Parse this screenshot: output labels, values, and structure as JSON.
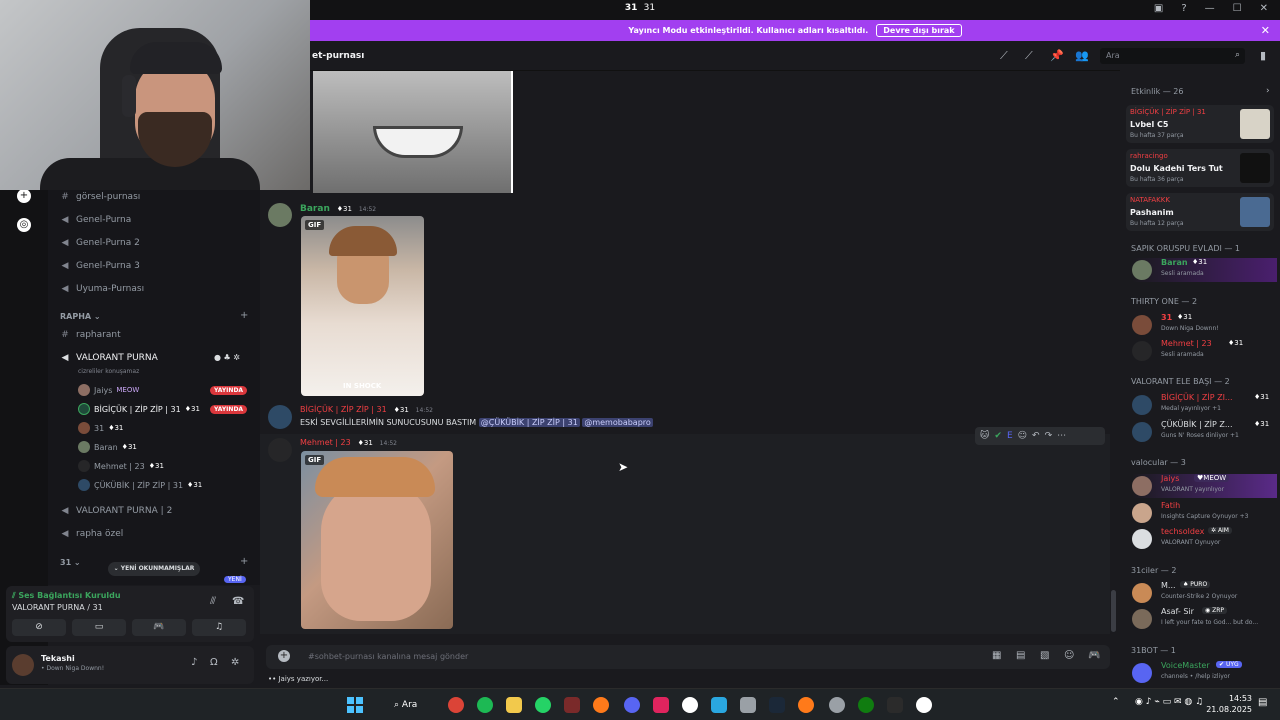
{
  "titlebar": {
    "title": "31",
    "subtitle": "31"
  },
  "banner": {
    "text": "Yayıncı Modu etkinleştirildi. Kullanıcı adları kısaltıldı.",
    "button": "Devre dışı bırak"
  },
  "channel": {
    "name": "et-purnası",
    "search_placeholder": "Ara"
  },
  "sidebar": {
    "channels": [
      "görsel-purnası",
      "Genel-Purna",
      "Genel-Purna 2",
      "Genel-Purna 3",
      "Uyuma-Purnası"
    ],
    "category_rapha": "RAPHA",
    "rapharant": "rapharant",
    "valorant_purna": "VALORANT PURNA",
    "valorant_sub": "cizreliler konuşamaz",
    "voice_users": [
      {
        "name": "Jaiys",
        "tag": "MEOW",
        "live": "YAYINDA"
      },
      {
        "name": "BİGİÇÜK | ZİP ZİP | 31",
        "tag": "31",
        "live": "YAYINDA"
      },
      {
        "name": "31",
        "tag": "31",
        "live": ""
      },
      {
        "name": "Baran",
        "tag": "31",
        "live": ""
      },
      {
        "name": "Mehmet | 23",
        "tag": "31",
        "live": ""
      },
      {
        "name": "ÇÜKÜBİK | ZİP ZİP | 31",
        "tag": "31",
        "live": ""
      }
    ],
    "valorant2": "VALORANT PURNA | 2",
    "rapha_ozel": "rapha özel",
    "category_31": "31",
    "new_unread": "YENİ OKUNMAMIŞLAR",
    "yeni": "YENİ"
  },
  "voice_panel": {
    "status": "Ses Bağlantısı Kuruldu",
    "channel": "VALORANT PURNA / 31"
  },
  "user_panel": {
    "name": "Tekashi",
    "status": "Down Niga Downn!"
  },
  "messages": [
    {
      "author": "Baran",
      "tag": "31",
      "time": "14:52",
      "gif": "GIF",
      "caption": "IN SHOCK"
    },
    {
      "author": "BİGİÇÜK | ZİP ZİP | 31",
      "tag": "31",
      "time": "14:52",
      "text": "ESKİ SEVGİLİLERİMİN SUNUCUSUNU BASTIM",
      "mention1": "@ÇÜKÜBİK | ZİP ZİP | 31",
      "mention2": "@memobabapro"
    },
    {
      "author": "Mehmet | 23",
      "tag": "31",
      "time": "14:52",
      "gif": "GIF"
    }
  ],
  "composer": {
    "placeholder": "#sohbet-purnası kanalına mesaj gönder",
    "typing": "Jaiys yazıyor..."
  },
  "right": {
    "activity_header": "Etkinlik — 26",
    "activities": [
      {
        "user": "BİGİÇÜK | ZİP ZİP | 31",
        "title": "Lvbel C5",
        "sub": "Bu hafta 37 parça"
      },
      {
        "user": "rahracingo",
        "title": "Dolu Kadehi Ters Tut",
        "sub": "Bu hafta 36 parça"
      },
      {
        "user": "NATAFAKKK",
        "title": "Pashanim",
        "sub": "Bu hafta 12 parça"
      }
    ],
    "groups": [
      {
        "header": "SAPIK ORUSPU EVLADI — 1",
        "members": [
          {
            "name": "Baran",
            "tag": "31",
            "status": "Sesli aramada",
            "color": "#3ba55d"
          }
        ]
      },
      {
        "header": "THIRTY ONE — 2",
        "members": [
          {
            "name": "31",
            "tag": "31",
            "status": "Down Niga Downn!",
            "color": "#f23f43"
          },
          {
            "name": "Mehmet | 23",
            "tag": "31",
            "status": "Sesli aramada",
            "color": "#f23f43"
          }
        ]
      },
      {
        "header": "VALORANT ELE BAŞI — 2",
        "members": [
          {
            "name": "BİGİÇÜK | ZİP ZI...",
            "tag": "31",
            "status": "Medal yayınlıyor +1",
            "color": "#f23f43"
          },
          {
            "name": "ÇÜKÜBİK | ZİP Z...",
            "tag": "31",
            "status": "Guns N' Roses dinliyor +1",
            "color": "#dbdee1"
          }
        ]
      },
      {
        "header": "valocular — 3",
        "members": [
          {
            "name": "Jaiys",
            "tag": "MEOW",
            "status": "VALORANT yayınlıyor",
            "color": "#f23f43"
          },
          {
            "name": "Fatih",
            "tag": "",
            "status": "Insights Capture Oynuyor +3",
            "color": "#f23f43"
          },
          {
            "name": "techsoldex",
            "tag": "AIM",
            "status": "VALORANT Oynuyor",
            "color": "#f23f43"
          }
        ]
      },
      {
        "header": "31ciler — 2",
        "members": [
          {
            "name": "M...",
            "tag": "PURO",
            "status": "Counter-Strike 2 Oynuyor",
            "color": "#dbdee1"
          },
          {
            "name": "Asaf- Sir",
            "tag": "ZRP",
            "status": "I left your fate to God... but do...",
            "color": "#dbdee1"
          }
        ]
      },
      {
        "header": "31BOT — 1",
        "members": [
          {
            "name": "VoiceMaster",
            "tag": "UYG",
            "status": "channels • /help izliyor",
            "color": "#3ba55d"
          }
        ]
      }
    ]
  },
  "taskbar": {
    "search": "Ara",
    "time": "14:53",
    "date": "21.08.2025"
  }
}
